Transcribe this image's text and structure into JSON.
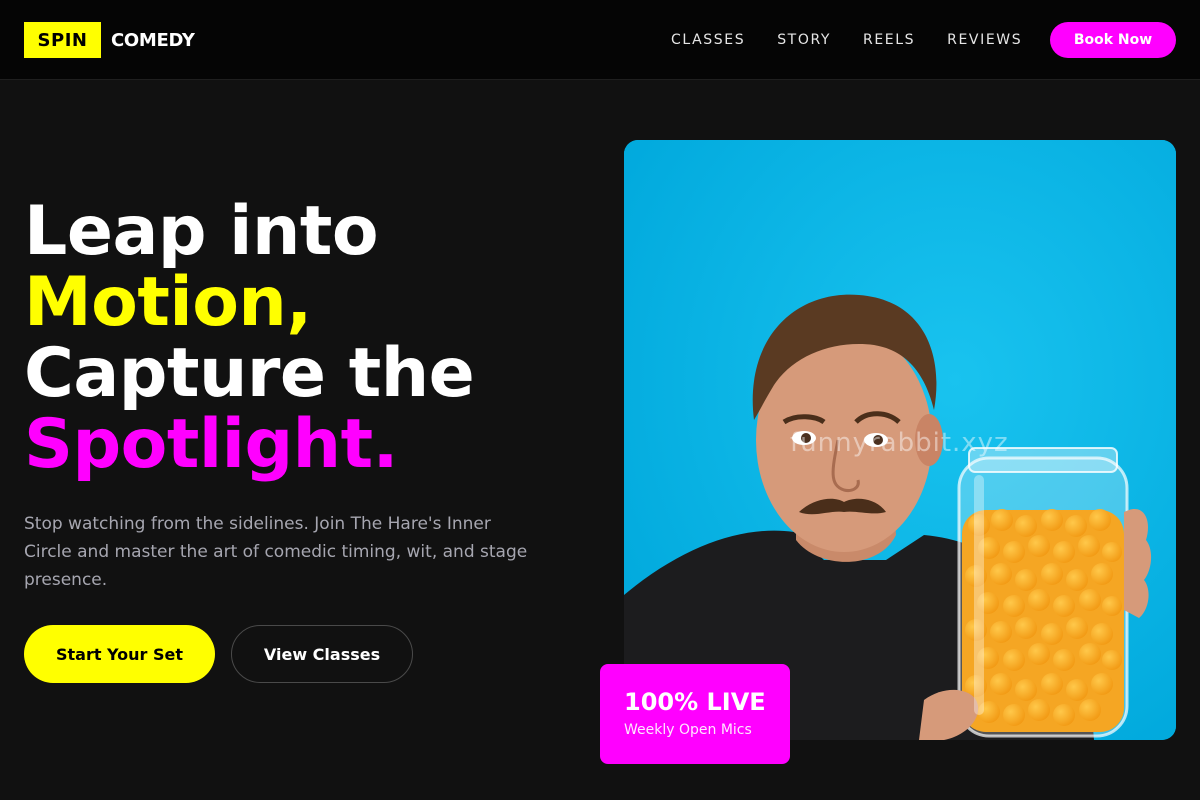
{
  "header": {
    "logo_box": "SPIN",
    "logo_text": "COMEDY",
    "nav": [
      "CLASSES",
      "STORY",
      "REELS",
      "REVIEWS"
    ],
    "cta": "Book Now"
  },
  "hero": {
    "headline": {
      "line1": "Leap into",
      "line2": "Motion,",
      "line3": "Capture the",
      "line4": "Spotlight."
    },
    "subtext": "Stop watching from the sidelines. Join The Hare's Inner Circle and master the art of comedic timing, wit, and stage presence.",
    "primary_button": "Start Your Set",
    "secondary_button": "View Classes",
    "image": {
      "watermark": "funnyrabbit.xyz",
      "alt": "man holding a jar of cheese puffs"
    },
    "badge": {
      "title": "100% LIVE",
      "subtitle": "Weekly Open Mics"
    }
  },
  "colors": {
    "background": "#111111",
    "accent_yellow": "#ffff00",
    "accent_magenta": "#ff00ff",
    "photo_background": "#00b4e4"
  }
}
